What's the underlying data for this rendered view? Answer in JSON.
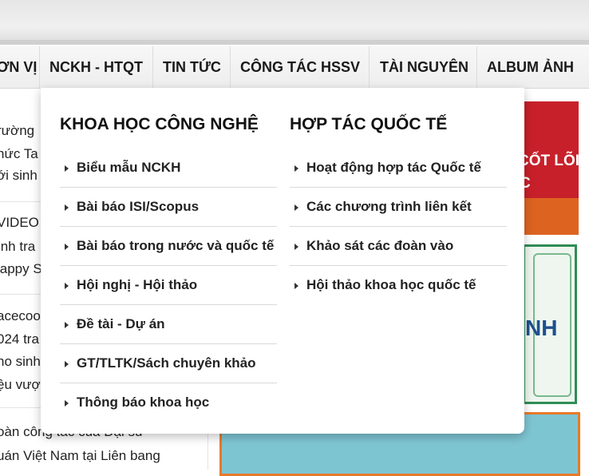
{
  "nav": {
    "items": [
      "ƠN VỊ",
      "NCKH - HTQT",
      "TIN TỨC",
      "CÔNG TÁC HSSV",
      "TÀI NGUYÊN",
      "ALBUM ẢNH"
    ]
  },
  "background": {
    "left_lines": [
      "rường",
      "hức Ta",
      "ới sinh",
      "VIDEO",
      "ình tra",
      "lappy S",
      "acecoo",
      "024 tra",
      "ho sinh",
      "ệu vượ",
      "oàn công tác của Đại sứ",
      "uán Việt Nam tại Liên bang"
    ],
    "banner_red_text_1": "CỐT LÕI",
    "banner_red_text_2": "C",
    "banner_cert_text": "NH"
  },
  "dropdown": {
    "col1": {
      "title": "KHOA HỌC CÔNG NGHỆ",
      "items": [
        "Biểu mẫu NCKH",
        "Bài báo ISI/Scopus",
        "Bài báo trong nước và quốc tế",
        "Hội nghị - Hội thảo",
        "Đề tài - Dự án",
        "GT/TLTK/Sách chuyên khảo",
        "Thông báo khoa học"
      ]
    },
    "col2": {
      "title": "HỢP TÁC QUỐC TẾ",
      "items": [
        "Hoạt động hợp tác Quốc tế",
        "Các chương trình liên kết",
        "Khảo sát các đoàn vào",
        "Hội thảo khoa học quốc tế"
      ]
    }
  },
  "colors": {
    "accent_red": "#c8202a",
    "nav_bg": "#f2f2f2",
    "text": "#1a1a1a"
  }
}
